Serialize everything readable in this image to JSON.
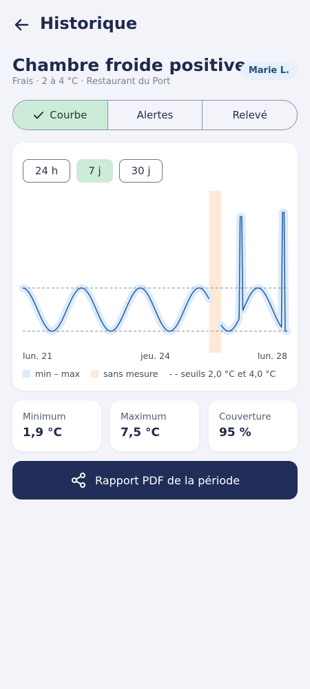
{
  "header": {
    "title": "Historique",
    "back_icon": "arrow-left-icon"
  },
  "room": {
    "name": "Chambre froide positive",
    "subtitle": "Frais · 2 à 4 °C · Restaurant du Port",
    "user": "Marie L."
  },
  "tabs": [
    {
      "label": "Courbe",
      "active": true,
      "icon": "check-icon"
    },
    {
      "label": "Alertes",
      "active": false
    },
    {
      "label": "Relevé",
      "active": false
    }
  ],
  "ranges": [
    {
      "label": "24 h",
      "active": false
    },
    {
      "label": "7 j",
      "active": true
    },
    {
      "label": "30 j",
      "active": false
    }
  ],
  "chart_data": {
    "type": "line",
    "x_labels": [
      "lun. 21",
      "jeu. 24",
      "lun. 28"
    ],
    "x_range": [
      "lun. 21",
      "lun. 28"
    ],
    "y_range": [
      1.0,
      8.5
    ],
    "thresholds": [
      2.0,
      4.0
    ],
    "temperature_profile": {
      "baseline_cycle": {
        "min": 2.0,
        "max": 4.0,
        "cycles_in_period": 4.5
      },
      "gap_no_data": {
        "start_fraction": 0.705,
        "end_fraction": 0.75
      },
      "spikes": [
        {
          "at_fraction": 0.825,
          "peak": 7.3
        },
        {
          "at_fraction": 0.985,
          "peak": 7.5
        }
      ]
    },
    "colors": {
      "line": "#2b62a6",
      "band": "#dcebfb",
      "gap": "#fde9d6",
      "threshold": "#8a8f9c"
    },
    "legend": {
      "minmax": "min – max",
      "gap": "sans mesure",
      "thresholds": "- - seuils 2,0 °C et 4,0 °C"
    }
  },
  "stats": [
    {
      "label": "Minimum",
      "value": "1,9 °C"
    },
    {
      "label": "Maximum",
      "value": "7,5 °C"
    },
    {
      "label": "Couverture",
      "value": "95 %"
    }
  ],
  "actions": {
    "pdf_label": "Rapport PDF de la période",
    "pdf_icon": "share-icon"
  }
}
